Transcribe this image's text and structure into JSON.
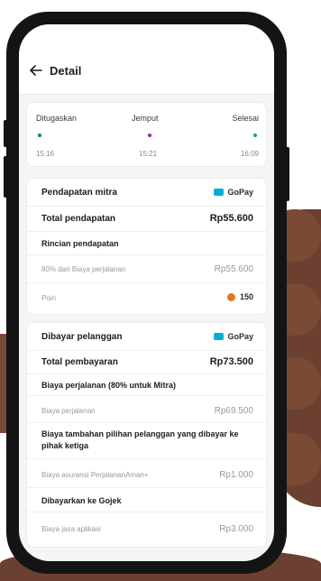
{
  "header": {
    "title": "Detail",
    "back_icon": "arrow-left-icon"
  },
  "status": {
    "steps": [
      {
        "label": "Ditugaskan",
        "time": "15:16",
        "color": "#0f7d86"
      },
      {
        "label": "Jemput",
        "time": "15:21",
        "color": "#8b2fa8"
      },
      {
        "label": "Selesai",
        "time": "16:09",
        "color": "#1aa84a"
      }
    ]
  },
  "mitra": {
    "title": "Pendapatan mitra",
    "method": "GoPay",
    "total_label": "Total pendapatan",
    "total_value": "Rp55.600",
    "detail_heading": "Rincian pendapatan",
    "share_label": "80% dari Biaya perjalanan",
    "share_value": "Rp55.600",
    "poin_label": "Poin",
    "poin_value": "150"
  },
  "pelanggan": {
    "title": "Dibayar pelanggan",
    "method": "GoPay",
    "total_label": "Total pembayaran",
    "total_value": "Rp73.500",
    "trip_heading": "Biaya perjalanan (80% untuk Mitra)",
    "trip_label": "Biaya perjalanan",
    "trip_value": "Rp69.500",
    "extra_heading": "Biaya tambahan pilihan pelanggan yang dibayar ke pihak ketiga",
    "insurance_label": "Biaya asuransi PerjalananAman+",
    "insurance_value": "Rp1.000",
    "gojek_heading": "Dibayarkan ke Gojek",
    "app_label": "Biaya jasa aplikasi",
    "app_value": "Rp3.000"
  }
}
